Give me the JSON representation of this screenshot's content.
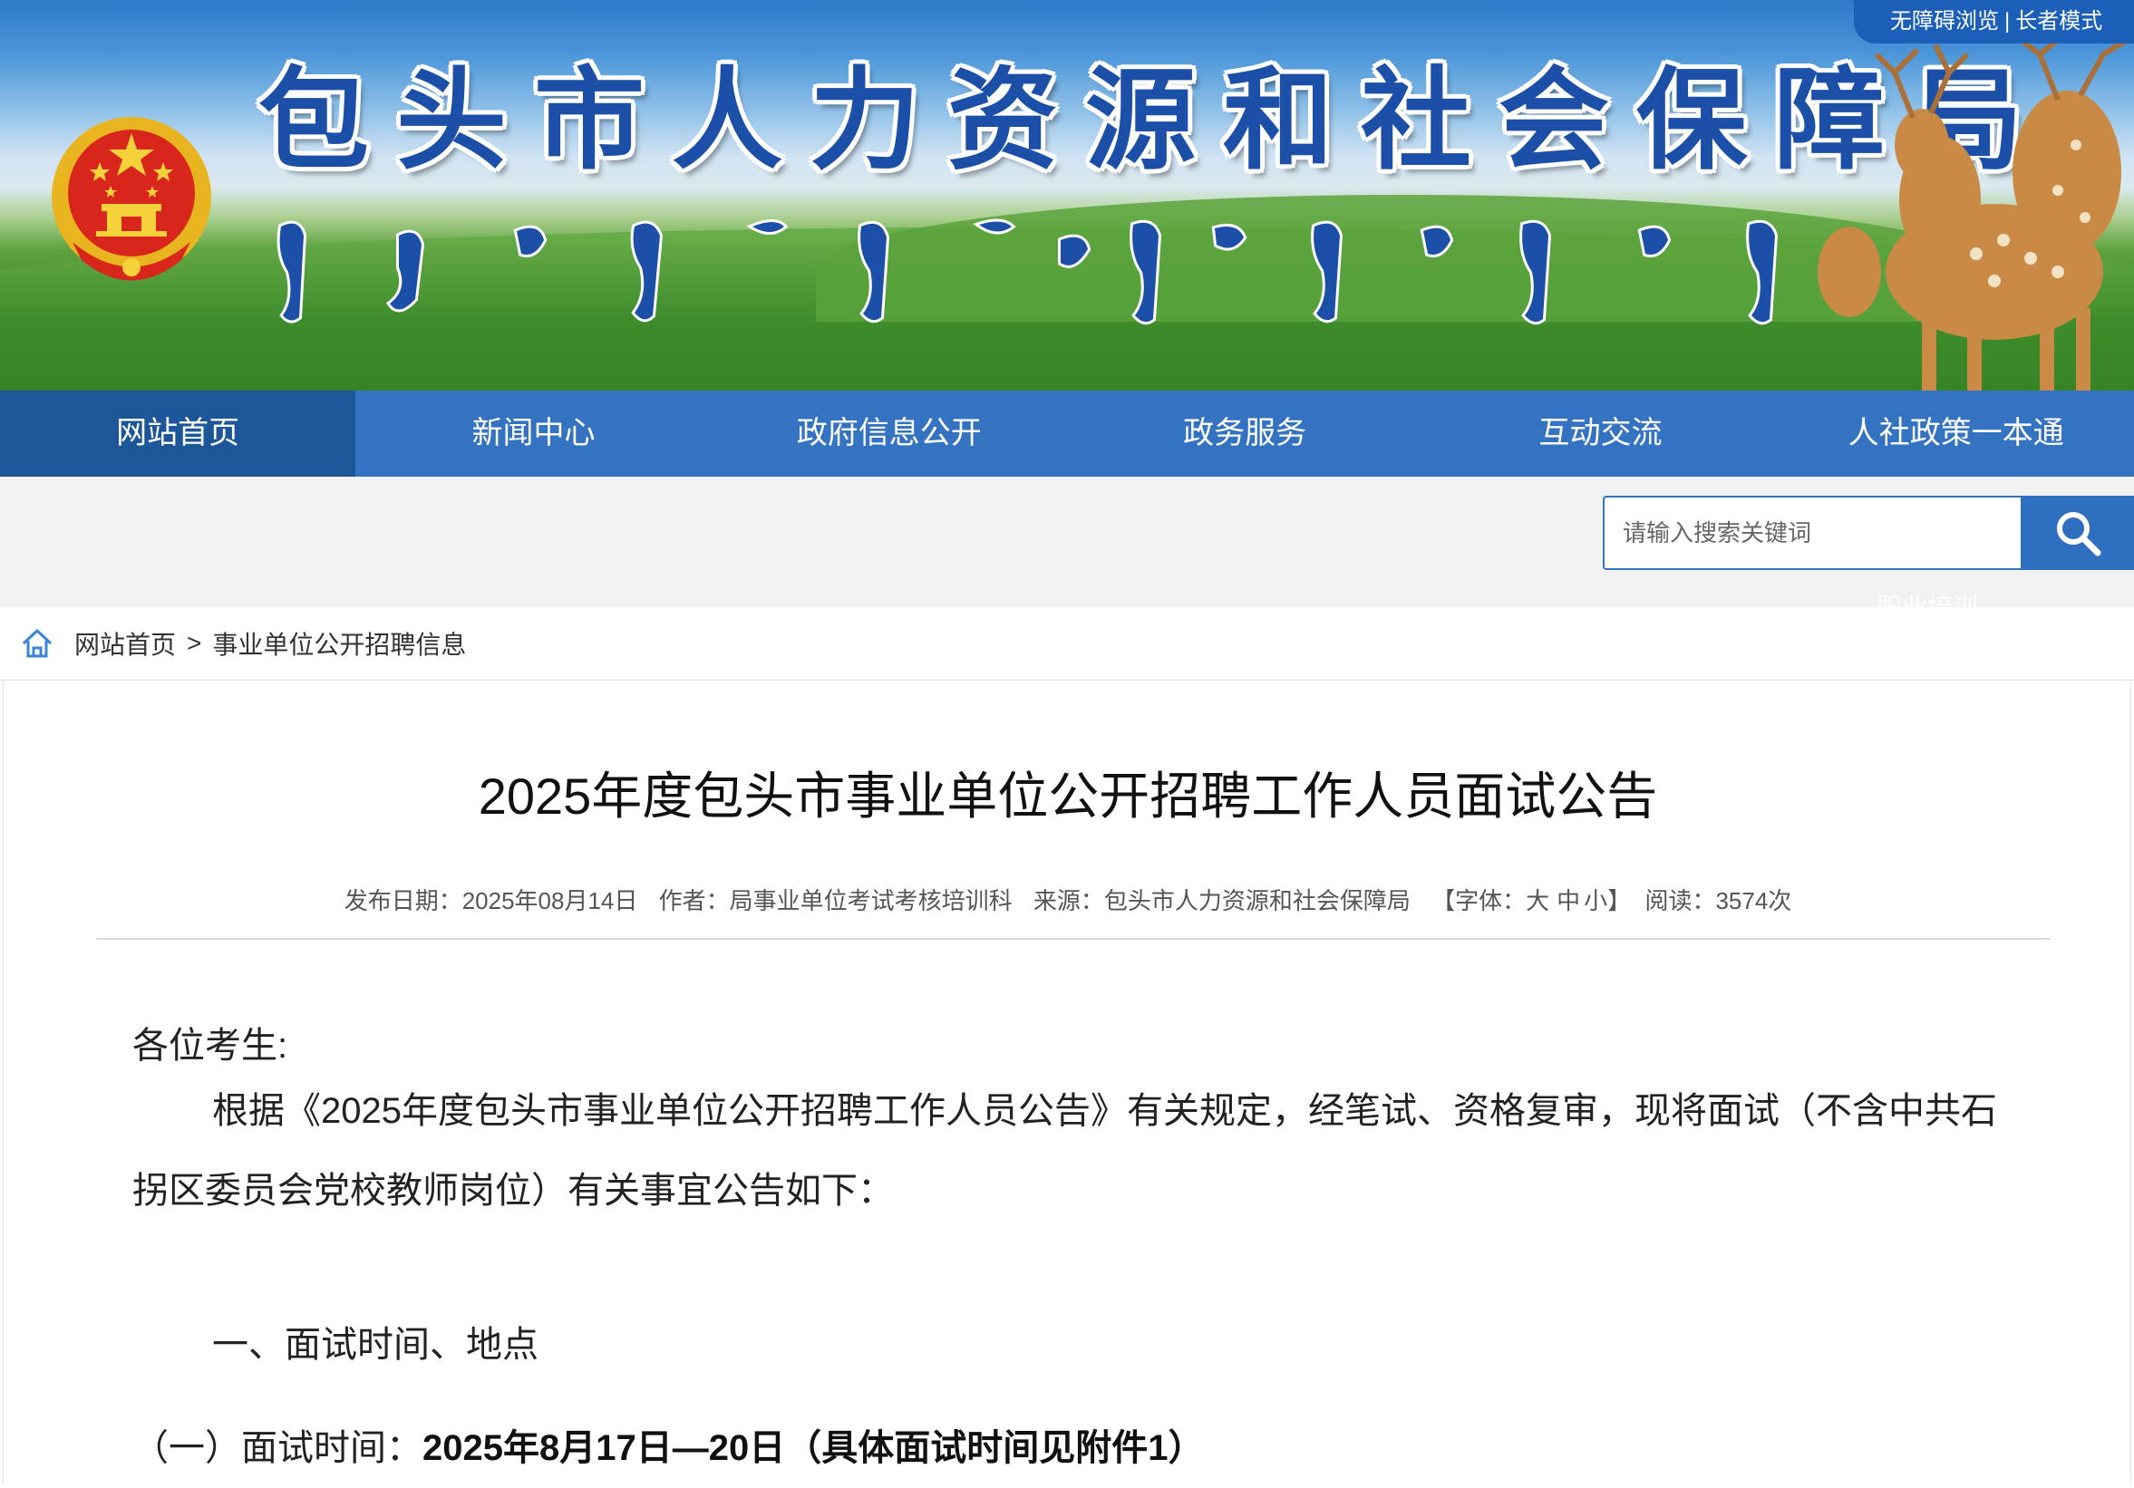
{
  "header": {
    "site_title": "包头市人力资源和社会保障局",
    "accessibility_link": "无障碍浏览",
    "accessibility_sep": "|",
    "elder_mode_link": "长者模式"
  },
  "nav": {
    "items": [
      {
        "label": "网站首页",
        "active": true
      },
      {
        "label": "新闻中心"
      },
      {
        "label": "政府信息公开"
      },
      {
        "label": "政务服务"
      },
      {
        "label": "互动交流"
      },
      {
        "label": "人社政策一本通"
      }
    ]
  },
  "search": {
    "placeholder": "请输入搜索关键词",
    "button_icon": "search-icon"
  },
  "ghost_text": "职业培训",
  "breadcrumb": {
    "home": "网站首页",
    "separator": ">",
    "current": "事业单位公开招聘信息"
  },
  "article": {
    "title": "2025年度包头市事业单位公开招聘工作人员面试公告",
    "meta": {
      "date": "发布日期：2025年08月14日",
      "author": "作者：局事业单位考试考核培训科",
      "source": "来源：包头市人力资源和社会保障局",
      "font_prefix": "【字体：",
      "font_large": "大",
      "font_medium": "中",
      "font_small": "小",
      "font_suffix": "】",
      "reads": "阅读：3574次"
    },
    "greeting": "各位考生:",
    "intro": "根据《2025年度包头市事业单位公开招聘工作人员公告》有关规定，经笔试、资格复审，现将面试（不含中共石拐区委员会党校教师岗位）有关事宜公告如下：",
    "section1": "一、面试时间、地点",
    "time_label": "（一）面试时间：",
    "time_value": "2025年8月17日—20日（具体面试时间见附件1）"
  },
  "colors": {
    "nav_bg": "#3473c2",
    "nav_active_bg": "#1d5699",
    "title_blue": "#1c4fa8",
    "access_bar_bg": "#1c5fb8"
  }
}
